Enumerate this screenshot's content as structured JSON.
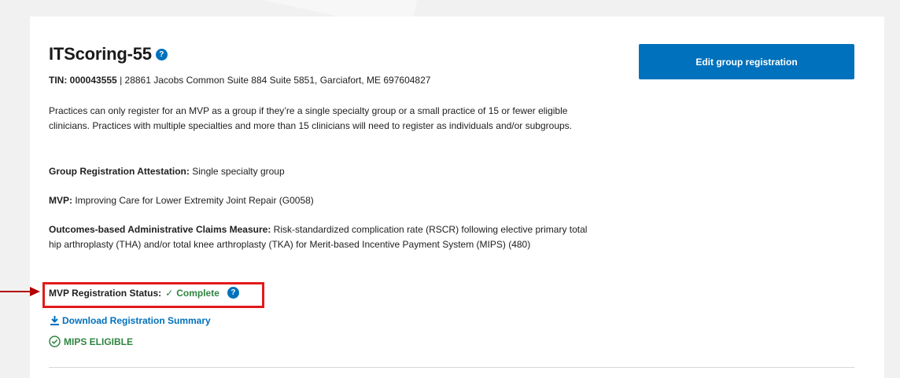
{
  "group": {
    "name": "ITScoring-55",
    "tin_label": "TIN: 000043555",
    "address": "28861 Jacobs Common Suite 884 Suite 5851, Garciafort, ME 697604827"
  },
  "info_paragraph": "Practices can only register for an MVP as a group if they’re a single specialty group or a small practice of 15 or fewer eligible clinicians. Practices with multiple specialties and more than 15 clinicians will need to register as individuals and/or subgroups.",
  "attestation": {
    "label": "Group Registration Attestation:",
    "value": "Single specialty group"
  },
  "mvp": {
    "label": "MVP:",
    "value": "Improving Care for Lower Extremity Joint Repair (G0058)"
  },
  "outcomes": {
    "label": "Outcomes-based Administrative Claims Measure:",
    "value": "Risk-standardized complication rate (RSCR) following elective primary total hip arthroplasty (THA) and/or total knee arthroplasty (TKA) for Merit-based Incentive Payment System (MIPS) (480)"
  },
  "status": {
    "label": "MVP Registration Status:",
    "value": "Complete",
    "color": "#2e8540"
  },
  "download": {
    "label": "Download Registration Summary"
  },
  "eligibility": {
    "label": "MIPS ELIGIBLE"
  },
  "actions": {
    "edit_label": "Edit group registration"
  },
  "colors": {
    "primary": "#0071bc",
    "success": "#2e8540",
    "highlight": "#e11a1a"
  }
}
